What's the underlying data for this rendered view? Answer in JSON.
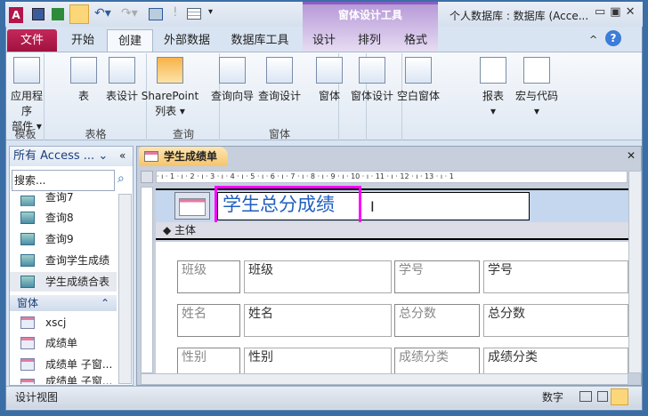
{
  "title_bar": {
    "window_title": "个人数据库 : 数据库 (Acce...",
    "contextual_group": "窗体设计工具"
  },
  "tabs": [
    {
      "label": "文件"
    },
    {
      "label": "开始"
    },
    {
      "label": "创建"
    },
    {
      "label": "外部数据"
    },
    {
      "label": "数据库工具"
    },
    {
      "label": "设计"
    },
    {
      "label": "排列"
    },
    {
      "label": "格式"
    }
  ],
  "ribbon": {
    "groups": [
      {
        "label": "模板"
      },
      {
        "label": "表格"
      },
      {
        "label": "查询"
      },
      {
        "label": "窗体"
      }
    ],
    "buttons": {
      "app_parts": "应用程序",
      "app_parts2": "部件",
      "table": "表",
      "table_design": "表设计",
      "sharepoint": "SharePoint",
      "sharepoint2": "列表",
      "query_wizard": "查询向导",
      "query_design": "查询设计",
      "form": "窗体",
      "form_design": "窗体设计",
      "blank_form": "空白窗体",
      "report": "报表",
      "macro": "宏与代码"
    }
  },
  "nav": {
    "header": "所有 Access ...",
    "search_placeholder": "搜索...",
    "queries": [
      {
        "label": "查询7"
      },
      {
        "label": "查询8"
      },
      {
        "label": "查询9"
      },
      {
        "label": "查询学生成绩"
      },
      {
        "label": "学生成绩合表"
      }
    ],
    "forms_header": "窗体",
    "forms": [
      {
        "label": "xscj"
      },
      {
        "label": "成绩单"
      },
      {
        "label": "成绩单 子窗..."
      },
      {
        "label": "成绩单 子窗..."
      }
    ]
  },
  "document": {
    "tab": "学生成绩单",
    "ruler": "· ı · 1 · ı · 2 · ı · 3 · ı · 4 · ı · 5 · ı · 6 · ı · 7 · ı · 8 · ı · 9 · ı · 10 · ı · 11 · ı · 12 · ı · 13 · ı · 1",
    "form_title": "学生总分成绩",
    "detail_section": "主体",
    "fields": [
      {
        "label": "班级",
        "value": "班级"
      },
      {
        "label": "学号",
        "value": "学号"
      },
      {
        "label": "姓名",
        "value": "姓名"
      },
      {
        "label": "总分数",
        "value": "总分数"
      },
      {
        "label": "性别",
        "value": "性别"
      },
      {
        "label": "成绩分类",
        "value": "成绩分类"
      }
    ]
  },
  "status": {
    "view": "设计视图",
    "numlock": "数字"
  },
  "colors": {
    "file_tab": "#b3154a",
    "highlight": "#ff00ff",
    "form_header": "#c5d7ee",
    "contextual": "#b89ad8"
  }
}
